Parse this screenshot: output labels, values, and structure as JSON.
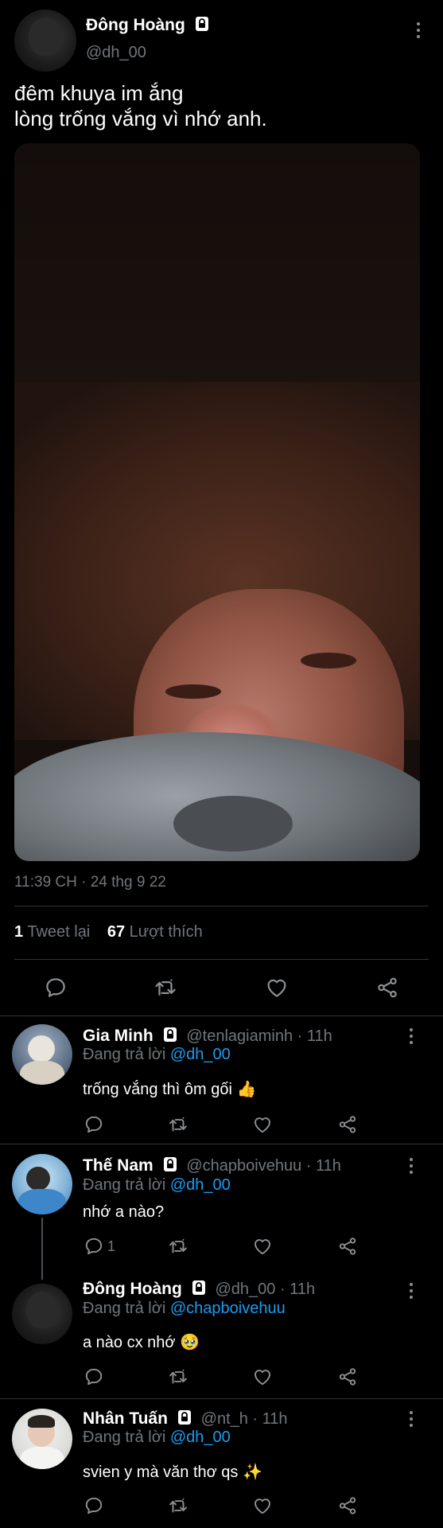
{
  "main_tweet": {
    "display_name": "Đông Hoàng",
    "handle": "@dh_00",
    "text_line1": "đêm khuya im ắng",
    "text_line2": "lòng trống vắng vì nhớ anh.",
    "timestamp": "11:39 CH · 24 thg 9 22",
    "retweet_count": "1",
    "retweet_label": "Tweet lại",
    "like_count": "67",
    "like_label": "Lượt thích"
  },
  "replies": [
    {
      "display_name": "Gia Minh",
      "handle": "@tenlagiaminh · 11h",
      "replying_prefix": "Đang trả lời",
      "replying_to": "@dh_00",
      "text": "trống vắng thì ôm gối 👍",
      "reply_count": ""
    },
    {
      "display_name": "Thế Nam",
      "handle": "@chapboivehuu · 11h",
      "replying_prefix": "Đang trả lời",
      "replying_to": "@dh_00",
      "text": "nhớ a nào?",
      "reply_count": "1"
    },
    {
      "display_name": "Đông Hoàng",
      "handle": "@dh_00 · 11h",
      "replying_prefix": "Đang trả lời",
      "replying_to": "@chapboivehuu",
      "text": "a nào cx nhớ 🥹",
      "reply_count": ""
    },
    {
      "display_name": "Nhân Tuấn",
      "handle": "@nt_h · 11h",
      "replying_prefix": "Đang trả lời",
      "replying_to": "@dh_00",
      "text": "svien y mà văn thơ qs ✨",
      "reply_count": ""
    }
  ],
  "icons": {
    "reply": "reply-icon",
    "retweet": "retweet-icon",
    "like": "heart-icon",
    "share": "share-icon",
    "lock": "lock-icon",
    "more": "more-icon"
  },
  "colors": {
    "background": "#000000",
    "link": "#1d9bf0",
    "muted": "#71767b",
    "divider": "#2f3336"
  }
}
